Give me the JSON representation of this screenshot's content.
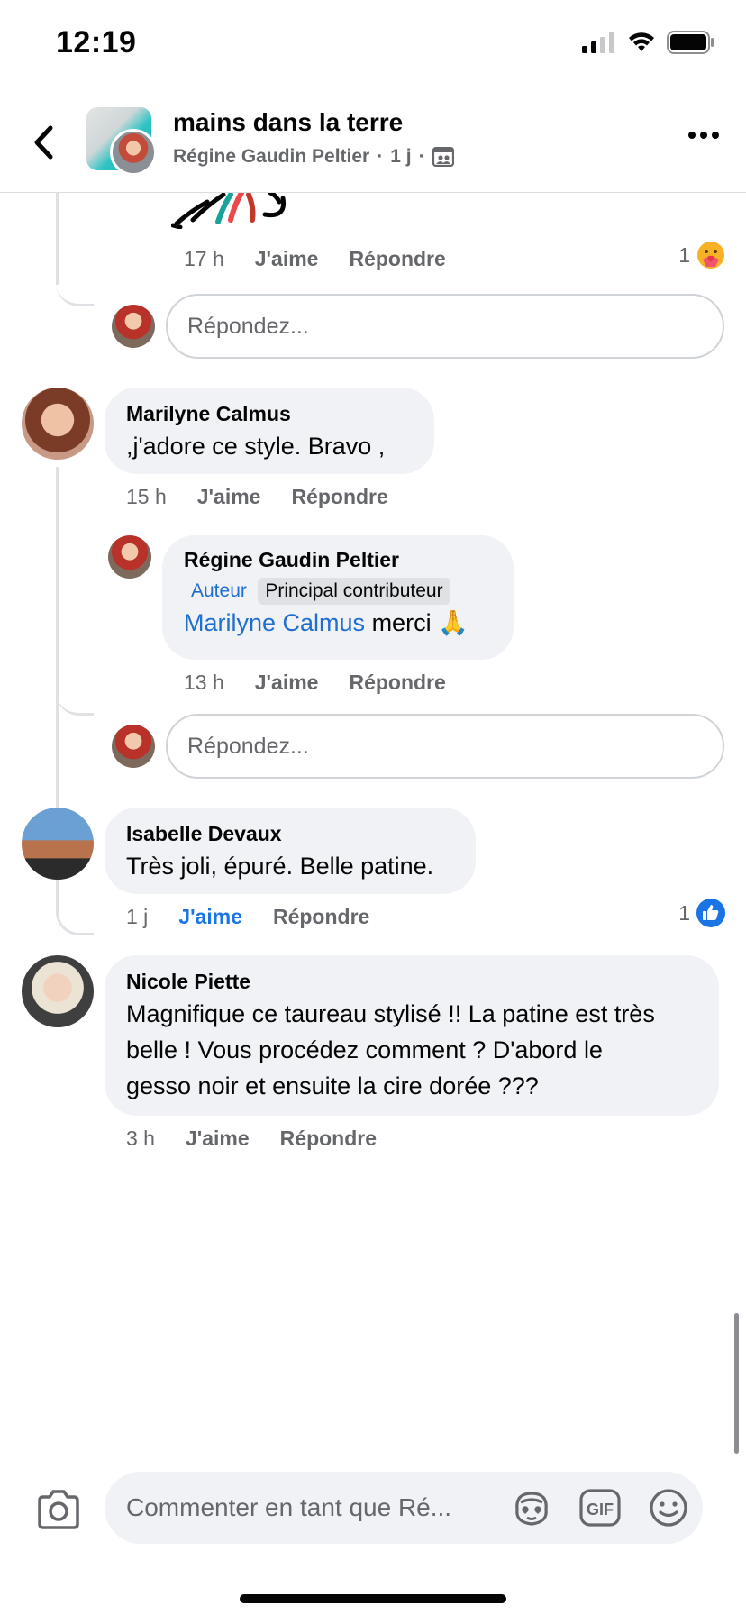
{
  "status_bar": {
    "time": "12:19"
  },
  "header": {
    "group_name": "mains dans la terre",
    "author": "Régine Gaudin Peltier",
    "age": "1 j",
    "separator": "·"
  },
  "thread_top": {
    "time": "17 h",
    "like_label": "J'aime",
    "reply_label": "Répondre",
    "reaction_count": "1",
    "reply_placeholder": "Répondez..."
  },
  "comments": [
    {
      "author": "Marilyne Calmus",
      "text": ",j'adore ce style.  Bravo ,",
      "time": "15 h",
      "like_label": "J'aime",
      "reply_label": "Répondre",
      "reply": {
        "author": "Régine Gaudin Peltier",
        "badge_author": "Auteur",
        "badge_contrib": "Principal contributeur",
        "mention": "Marilyne Calmus",
        "text": " merci 🙏",
        "time": "13 h",
        "like_label": "J'aime",
        "reply_label": "Répondre"
      },
      "reply_placeholder": "Répondez..."
    },
    {
      "author": "Isabelle Devaux",
      "text": "Très joli, épuré. Belle patine.",
      "time": "1 j",
      "like_label": "J'aime",
      "reply_label": "Répondre",
      "reaction_count": "1"
    },
    {
      "author": "Nicole Piette",
      "text_lines": [
        "Magnifique ce taureau stylisé !! La patine est très",
        "belle ! Vous procédez comment ? D'abord le",
        "gesso noir et ensuite la cire dorée ???"
      ],
      "time": "3 h",
      "like_label": "J'aime",
      "reply_label": "Répondre"
    }
  ],
  "composer": {
    "placeholder": "Commenter en tant que Ré...",
    "gif_label": "GIF"
  },
  "colors": {
    "link_blue": "#1e6fd0",
    "like_blue": "#1b74e4",
    "bubble_bg": "#f0f2f5",
    "muted_text": "#65676b"
  }
}
